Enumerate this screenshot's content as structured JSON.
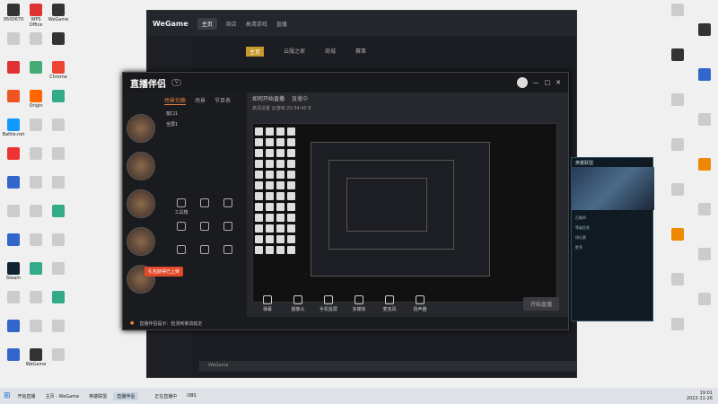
{
  "desktop": {
    "left_icons": [
      {
        "label": "9500670",
        "color": "#333"
      },
      {
        "label": "WPS Office",
        "color": "#d33"
      },
      {
        "label": "WeGame",
        "color": "#333"
      },
      {
        "label": "",
        "color": "#ccc"
      },
      {
        "label": "",
        "color": "#ccc"
      },
      {
        "label": "",
        "color": "#333"
      },
      {
        "label": "",
        "color": "#d33"
      },
      {
        "label": "",
        "color": "#4a7"
      },
      {
        "label": "Chrome",
        "color": "#e43"
      },
      {
        "label": "",
        "color": "#e52"
      },
      {
        "label": "Origin",
        "color": "#f60"
      },
      {
        "label": "",
        "color": "#3a8"
      },
      {
        "label": "Battle.net",
        "color": "#19f"
      },
      {
        "label": "",
        "color": "#ccc"
      },
      {
        "label": "",
        "color": "#ccc"
      },
      {
        "label": "",
        "color": "#e33"
      },
      {
        "label": "",
        "color": "#ccc"
      },
      {
        "label": "",
        "color": "#ccc"
      },
      {
        "label": "",
        "color": "#36c"
      },
      {
        "label": "",
        "color": "#ccc"
      },
      {
        "label": "",
        "color": "#ccc"
      },
      {
        "label": "",
        "color": "#ccc"
      },
      {
        "label": "",
        "color": "#ccc"
      },
      {
        "label": "",
        "color": "#3a8"
      },
      {
        "label": "",
        "color": "#36c"
      },
      {
        "label": "",
        "color": "#ccc"
      },
      {
        "label": "",
        "color": "#ccc"
      },
      {
        "label": "Steam",
        "color": "#123"
      },
      {
        "label": "",
        "color": "#3a8"
      },
      {
        "label": "",
        "color": "#ccc"
      },
      {
        "label": "",
        "color": "#ccc"
      },
      {
        "label": "",
        "color": "#ccc"
      },
      {
        "label": "",
        "color": "#3a8"
      },
      {
        "label": "",
        "color": "#36c"
      },
      {
        "label": "",
        "color": "#ccc"
      },
      {
        "label": "",
        "color": "#ccc"
      },
      {
        "label": "",
        "color": "#36c"
      },
      {
        "label": "WeGame",
        "color": "#333"
      },
      {
        "label": "",
        "color": "#ccc"
      }
    ],
    "right_icons": [
      {
        "label": "",
        "color": "#ccc"
      },
      {
        "label": "",
        "color": "#333"
      },
      {
        "label": "",
        "color": "#333"
      },
      {
        "label": "",
        "color": "#36c"
      },
      {
        "label": "",
        "color": "#ccc"
      },
      {
        "label": "",
        "color": "#ccc"
      },
      {
        "label": "",
        "color": "#ccc"
      },
      {
        "label": "",
        "color": "#e80"
      },
      {
        "label": "",
        "color": "#ccc"
      },
      {
        "label": "",
        "color": "#ccc"
      },
      {
        "label": "",
        "color": "#e80"
      },
      {
        "label": "",
        "color": "#ccc"
      },
      {
        "label": "",
        "color": "#ccc"
      },
      {
        "label": "",
        "color": "#ccc"
      },
      {
        "label": "",
        "color": "#ccc"
      }
    ]
  },
  "wegame": {
    "logo": "WeGame",
    "tabs": [
      "主页",
      "商店",
      "高清游戏",
      "直播"
    ],
    "active_tab": 0,
    "subnav": [
      "主页",
      "云服之家",
      "商城",
      "赛事"
    ],
    "search_text": "WeGame"
  },
  "zb": {
    "logo": "直播伴侣",
    "tag": "V",
    "scene_tabs": [
      "场景切换",
      "场景",
      "节目表"
    ],
    "scene_rows": [
      "窗口1",
      "全屏1"
    ],
    "head_title": "如何开始直播",
    "head_status": "直播中",
    "head_info": "高清设置  云游戏  20:34:40  8",
    "tools": [
      "工具箱",
      "",
      "",
      "",
      "",
      "",
      "",
      "",
      ""
    ],
    "promo": "礼包获得已上架",
    "bottom_tools": [
      "弹幕",
      "摄像头",
      "手机投屏",
      "多媒体",
      "麦克风",
      "扬声器"
    ],
    "start_label": "开始直播",
    "status_text": "直播伴侣提示：检测到推流稳定"
  },
  "lol": {
    "title": "英雄联盟",
    "lines": [
      "召唤师 ",
      "等级信息",
      "排位赛 ",
      "胜率",
      "",
      "",
      "",
      "",
      "",
      ""
    ]
  },
  "taskbar": {
    "items": [
      "开始直播",
      "主页 - WeGame",
      "英雄联盟",
      "直播伴侣",
      "",
      "正在直播中",
      "OBS"
    ],
    "active": 3,
    "time": "19:01",
    "date": "2022-11-26"
  }
}
